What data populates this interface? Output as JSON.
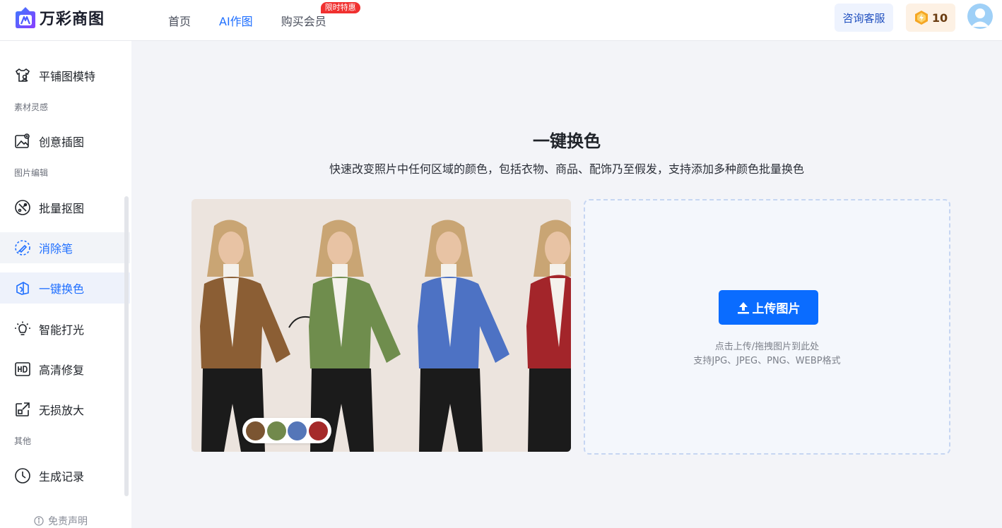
{
  "header": {
    "brand": "万彩商图",
    "nav": [
      {
        "label": "首页"
      },
      {
        "label": "AI作图"
      },
      {
        "label": "购买会员",
        "badge": "限时特惠"
      }
    ],
    "support_label": "咨询客服",
    "points": "10"
  },
  "sidebar": {
    "items": [
      {
        "label": "平铺图模特",
        "icon": "shirt-model-icon"
      },
      {
        "label": "创意插图",
        "icon": "image-plus-icon"
      },
      {
        "label": "批量抠图",
        "icon": "cutout-icon"
      },
      {
        "label": "消除笔",
        "icon": "eraser-brush-icon"
      },
      {
        "label": "一键换色",
        "icon": "recolor-icon"
      },
      {
        "label": "智能打光",
        "icon": "lightbulb-icon"
      },
      {
        "label": "高清修复",
        "icon": "hd-icon"
      },
      {
        "label": "无损放大",
        "icon": "enlarge-icon"
      },
      {
        "label": "生成记录",
        "icon": "clock-icon"
      }
    ],
    "sections": [
      "素材灵感",
      "图片编辑",
      "其他"
    ],
    "disclaimer": "免责声明"
  },
  "main": {
    "title": "一键换色",
    "subtitle": "快速改变照片中任何区域的颜色，包括衣物、商品、配饰乃至假发，支持添加多种颜色批量换色",
    "swatch_colors": [
      "#7b5532",
      "#71894c",
      "#5576b8",
      "#a52a2a"
    ],
    "upload": {
      "button_label": "上传图片",
      "hint1": "点击上传/拖拽图片到此处",
      "hint2": "支持JPG、JPEG、PNG、WEBP格式"
    }
  },
  "colors": {
    "accent": "#0a6cff",
    "nav_active": "#1f6fff"
  }
}
